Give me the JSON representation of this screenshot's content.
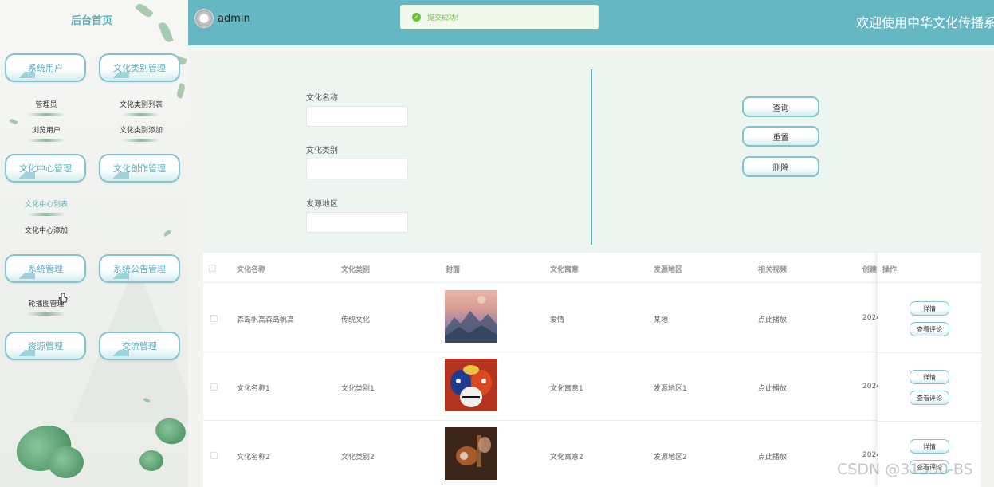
{
  "sidebar": {
    "title": "后台首页",
    "menus": [
      {
        "label": "系统用户"
      },
      {
        "label": "文化类别管理"
      },
      {
        "label": "文化中心管理"
      },
      {
        "label": "文化创作管理"
      },
      {
        "label": "系统管理"
      },
      {
        "label": "系统公告管理"
      },
      {
        "label": "资源管理"
      },
      {
        "label": "交流管理"
      }
    ],
    "subitems": [
      {
        "label": "管理员"
      },
      {
        "label": "浏览用户"
      },
      {
        "label": "文化类别列表"
      },
      {
        "label": "文化类别添加"
      },
      {
        "label": "文化中心列表"
      },
      {
        "label": "文化中心添加"
      },
      {
        "label": "轮播图管理"
      }
    ]
  },
  "header": {
    "username": "admin",
    "welcome": "欢迎使用中华文化传播系统"
  },
  "toast": {
    "message": "提交成功!"
  },
  "search": {
    "fields": [
      {
        "label": "文化名称",
        "value": "",
        "placeholder": ""
      },
      {
        "label": "文化类别",
        "value": "",
        "placeholder": ""
      },
      {
        "label": "发源地区",
        "value": "",
        "placeholder": ""
      }
    ],
    "buttons": [
      {
        "label": "查询"
      },
      {
        "label": "重置"
      },
      {
        "label": "删除"
      }
    ]
  },
  "table": {
    "columns": [
      "文化名称",
      "文化类别",
      "封面",
      "文化寓意",
      "发源地区",
      "相关视频",
      "创建",
      "操作"
    ],
    "rows": [
      {
        "name": "森岛帆高森岛帆高",
        "category": "传统文化",
        "meaning": "爱情",
        "region": "某地",
        "video": "点此播放",
        "created": "2024"
      },
      {
        "name": "文化名称1",
        "category": "文化类别1",
        "meaning": "文化寓意1",
        "region": "发源地区1",
        "video": "点此播放",
        "created": "2024"
      },
      {
        "name": "文化名称2",
        "category": "文化类别2",
        "meaning": "文化寓意2",
        "region": "发源地区2",
        "video": "点此播放",
        "created": "2024"
      }
    ],
    "actions": {
      "detail": "详情",
      "comments": "查看评论"
    }
  },
  "watermark": "CSDN @31330-BS"
}
